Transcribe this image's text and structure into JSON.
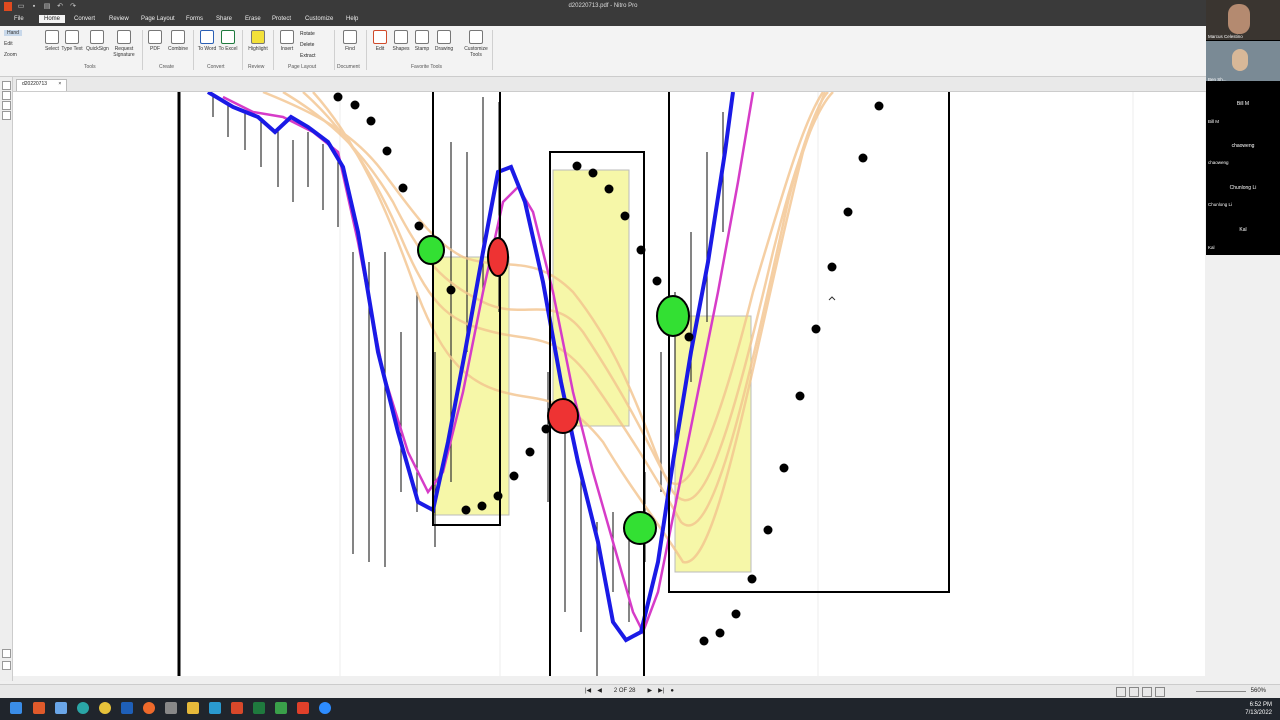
{
  "window": {
    "title": "d20220713.pdf - Nitro Pro"
  },
  "menu": {
    "items": [
      "File",
      "Home",
      "Convert",
      "Review",
      "Page Layout",
      "Forms",
      "Share",
      "Erase",
      "Protect",
      "Customize",
      "Help"
    ],
    "active": "Home"
  },
  "ribbon": {
    "left_tools": [
      "Hand",
      "Edit",
      "Zoom"
    ],
    "buttons": {
      "select": "Select",
      "type_text": "Type Text",
      "quicksign": "QuickSign",
      "request_signature": "Request Signature",
      "pdf": "PDF",
      "combine": "Combine",
      "to_word": "To Word",
      "to_excel": "To Excel",
      "highlight": "Highlight",
      "insert": "Insert",
      "rotate": "Rotate",
      "delete": "Delete",
      "extract": "Extract",
      "find": "Find",
      "edit": "Edit",
      "shapes": "Shapes",
      "stamp": "Stamp",
      "drawing": "Drawing",
      "customize_tools": "Customize Tools"
    },
    "groups": {
      "tools": "Tools",
      "create": "Create",
      "convert": "Convert",
      "review": "Review",
      "page_layout": "Page Layout",
      "document": "Document",
      "favorite": "Favorite Tools"
    }
  },
  "doc_tab": {
    "label": "d20220713"
  },
  "status": {
    "page_indicator": "2 OF 28",
    "zoom": "560%"
  },
  "clock": {
    "time": "6:52 PM",
    "date": "7/13/2022"
  },
  "participants": {
    "top": [
      "Marcus Celestino",
      "Ben Sh..."
    ],
    "names": [
      {
        "center": "Bill M",
        "corner": "Bill M"
      },
      {
        "center": "chaoweng",
        "corner": "chaoweng"
      },
      {
        "center": "Chunlong Li",
        "corner": "Chunlong Li"
      },
      {
        "center": "Kal",
        "corner": "Kal"
      }
    ]
  },
  "colors": {
    "green_marker": "#33e033",
    "red_marker": "#ee3333",
    "blue_line": "#1a1ae6",
    "magenta_line": "#d63cc8",
    "highlight_box": "#f6f7a8"
  }
}
